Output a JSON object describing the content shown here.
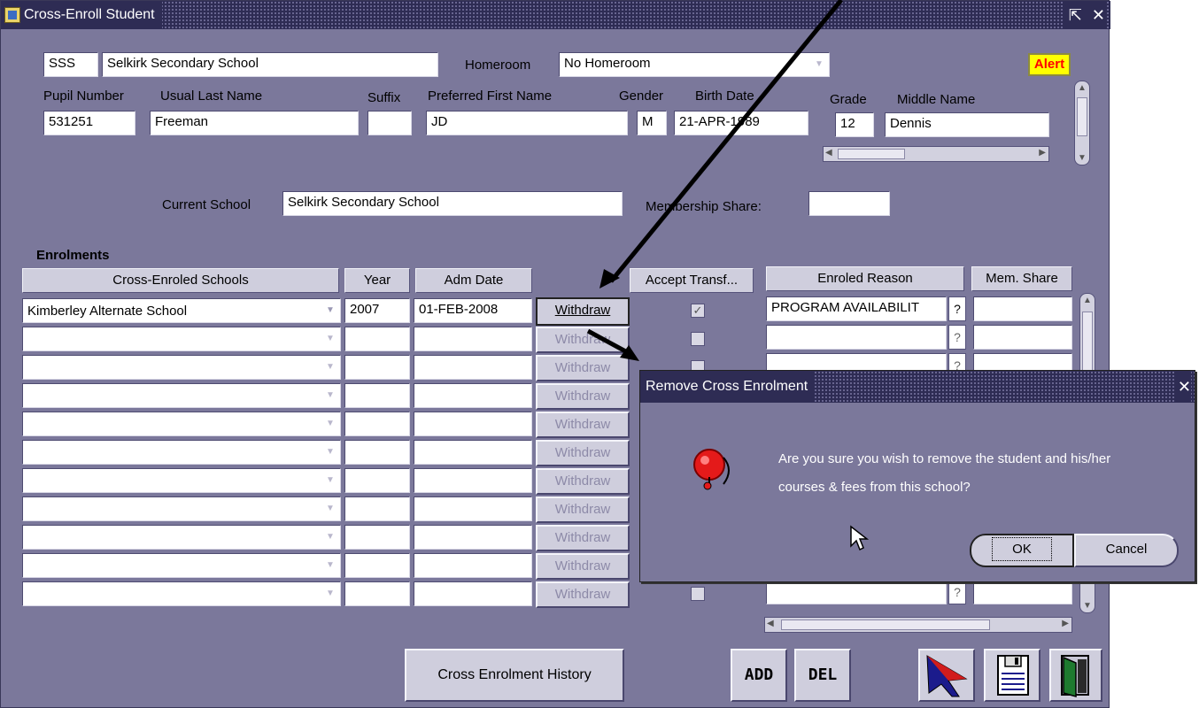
{
  "window": {
    "title": "Cross-Enroll Student",
    "restore_glyph": "⇱",
    "close_glyph": "✕"
  },
  "header": {
    "school_code": "SSS",
    "school_name": "Selkirk Secondary School",
    "homeroom_label": "Homeroom",
    "homeroom_value": "No Homeroom",
    "alert_label": "Alert"
  },
  "student": {
    "labels": {
      "pupil_number": "Pupil Number",
      "usual_last_name": "Usual Last Name",
      "suffix": "Suffix",
      "preferred_first_name": "Preferred First Name",
      "gender": "Gender",
      "birth_date": "Birth Date",
      "grade": "Grade",
      "middle_name": "Middle Name"
    },
    "values": {
      "pupil_number": "531251",
      "usual_last_name": "Freeman",
      "suffix": "",
      "preferred_first_name": "JD",
      "gender": "M",
      "birth_date": "21-APR-1989",
      "grade": "12",
      "middle_name": "Dennis"
    }
  },
  "current_school": {
    "label": "Current School",
    "value": "Selkirk Secondary School",
    "membership_share_label": "Membership Share:",
    "membership_share_value": ""
  },
  "enrolments": {
    "section_label": "Enrolments",
    "columns": {
      "school": "Cross-Enroled Schools",
      "year": "Year",
      "adm_date": "Adm Date",
      "accept_transfer": "Accept Transf...",
      "enroled_reason": "Enroled Reason",
      "mem_share": "Mem. Share"
    },
    "withdraw_label": "Withdraw",
    "question_glyph": "?",
    "check_glyph": "✓",
    "rows": [
      {
        "school": "Kimberley Alternate School",
        "year": "2007",
        "adm_date": "01-FEB-2008",
        "accept": true,
        "reason": "PROGRAM AVAILABILIT",
        "share": ""
      }
    ]
  },
  "buttons": {
    "history": "Cross Enrolment History",
    "add": "ADD",
    "del": "DEL"
  },
  "dialog": {
    "title": "Remove Cross Enrolment",
    "message_line1": "Are you sure you wish to remove the student and his/her",
    "message_line2": "courses & fees from this school?",
    "ok": "OK",
    "cancel": "Cancel"
  },
  "icons": {
    "app": "app-icon",
    "alarm": "alarm-bell-icon",
    "cursor": "mouse-pointer-icon",
    "select": "select-arrow-icon",
    "save": "save-icon",
    "exit": "exit-door-icon"
  },
  "colors": {
    "window_bg": "#7b789b",
    "titlebar_bg": "#2e2c54",
    "alert_bg": "#ffff00",
    "alert_fg": "#ff0000"
  }
}
